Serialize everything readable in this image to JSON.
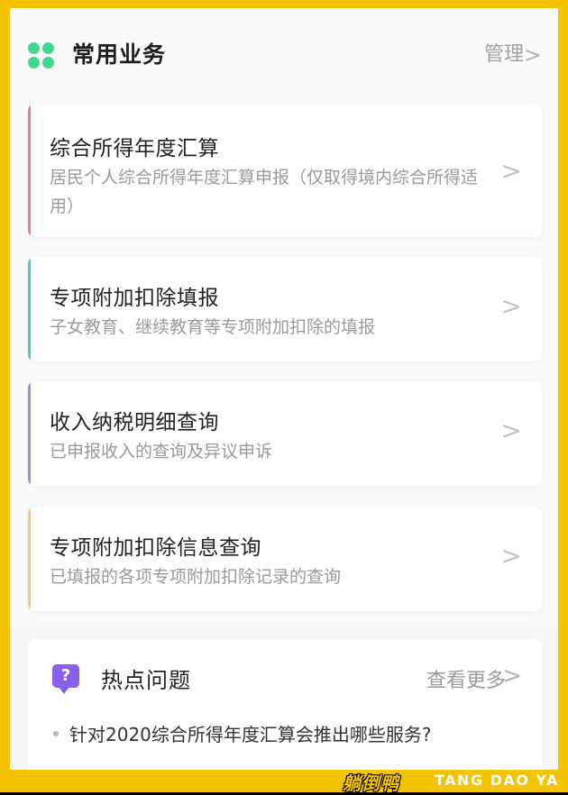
{
  "section": {
    "title": "常用业务",
    "manage_label": "管理",
    "manage_chevron": ">"
  },
  "cards": [
    {
      "title": "综合所得年度汇算",
      "desc": "居民个人综合所得年度汇算申报（仅取得境内综合所得适用）",
      "accent": "#f27a8c",
      "chevron": ">"
    },
    {
      "title": "专项附加扣除填报",
      "desc": "子女教育、继续教育等专项附加扣除的填报",
      "accent": "#4fd39a",
      "chevron": ">"
    },
    {
      "title": "收入纳税明细查询",
      "desc": "已申报收入的查询及异议申诉",
      "accent": "#9b8bf0",
      "chevron": ">"
    },
    {
      "title": "专项附加扣除信息查询",
      "desc": "已填报的各项专项附加扣除记录的查询",
      "accent": "#f5c97a",
      "chevron": ">"
    }
  ],
  "hot": {
    "title": "热点问题",
    "more_label": "查看更多",
    "more_chevron": ">",
    "icon_glyph": "?",
    "questions": [
      "针对2020综合所得年度汇算会推出哪些服务?"
    ]
  },
  "brand": {
    "cn": "躺倒鸭",
    "en": "TANG DAO YA"
  },
  "icons": {
    "logo": "clover-icon",
    "hot_icon": "question-bubble-icon"
  },
  "colors": {
    "logo_green": "#3ed98c",
    "hot_purple": "#8a5ff0",
    "frame_yellow": "#f5c400"
  }
}
